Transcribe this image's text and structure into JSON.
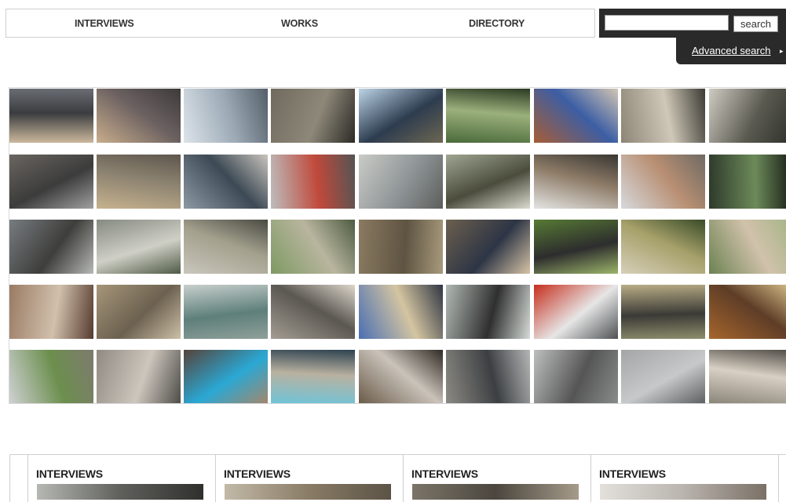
{
  "nav": {
    "interviews": "INTERVIEWS",
    "works": "WORKS",
    "directory": "DIRECTORY"
  },
  "search": {
    "value": "",
    "button_label": "search",
    "advanced_label": "Advanced search",
    "advanced_arrow": "▸"
  },
  "grid": {
    "rows": 5,
    "cols": 9,
    "thumbnails": [
      [
        "#cbb89c",
        "#3a3c40",
        "#6a6e74"
      ],
      [
        "#c9ad8c",
        "#6a6060",
        "#3e3a3a"
      ],
      [
        "#dde4ea",
        "#9aa8b4",
        "#545f68"
      ],
      [
        "#6f6a5e",
        "#8e8879",
        "#2c2a26"
      ],
      [
        "#bcd3e6",
        "#2d3c4f",
        "#6d6752"
      ],
      [
        "#4a6a3a",
        "#9bb07c",
        "#2a3a22"
      ],
      [
        "#a75d36",
        "#3c5ea4",
        "#d2c6b4"
      ],
      [
        "#8d8576",
        "#cfc8b8",
        "#3c3a34"
      ],
      [
        "#cfcbc2",
        "#5a5a50",
        "#2d2f2a"
      ],
      [
        "#6a6560",
        "#3c3c3c",
        "#a0a0a0"
      ],
      [
        "#c6b28e",
        "#8c8270",
        "#5d564c"
      ],
      [
        "#8d99a5",
        "#3d4a55",
        "#c9c4bd"
      ],
      [
        "#bdbdbd",
        "#c0493b",
        "#545454"
      ],
      [
        "#c9cbc6",
        "#8e9496",
        "#5c5e5b"
      ],
      [
        "#9fa692",
        "#4b4c3c",
        "#dbdcd0"
      ],
      [
        "#e4e4e2",
        "#8d7b67",
        "#383632"
      ],
      [
        "#d7d9dc",
        "#b88f73",
        "#6f6a63"
      ],
      [
        "#2e3a2b",
        "#6d8a5a",
        "#151a13"
      ],
      [
        "#777c80",
        "#3e3e3b",
        "#b7b9b6"
      ],
      [
        "#868a80",
        "#cfcfc6",
        "#4f5a45"
      ],
      [
        "#c9c6bc",
        "#a3a08d",
        "#4a4a42"
      ],
      [
        "#7e9a62",
        "#b9b59f",
        "#4d5c41"
      ],
      [
        "#8a7a60",
        "#5e5442",
        "#a89a7c"
      ],
      [
        "#6c5f4e",
        "#2d3545",
        "#d7c4a6"
      ],
      [
        "#577a34",
        "#2d2d2d",
        "#9cb56a"
      ],
      [
        "#d7cfb9",
        "#a6a06a",
        "#384b28"
      ],
      [
        "#6c8252",
        "#d1c2ab",
        "#a3b385"
      ],
      [
        "#9a7b64",
        "#d1c0ac",
        "#553a2e"
      ],
      [
        "#a69579",
        "#6c6150",
        "#cbbfa6"
      ],
      [
        "#c7cfcc",
        "#5e7f7b",
        "#8fa09a"
      ],
      [
        "#a39d92",
        "#5b5751",
        "#ddd7cc"
      ],
      [
        "#4a6fb3",
        "#d4c5a1",
        "#2f3543"
      ],
      [
        "#b1b9b4",
        "#2f2f2f",
        "#d6dcd8"
      ],
      [
        "#c62e1d",
        "#e6e6e6",
        "#4e5053"
      ],
      [
        "#b9ad86",
        "#3b3a36",
        "#8d8e6c"
      ],
      [
        "#a6652c",
        "#5e3d27",
        "#d7c08a"
      ],
      [
        "#cfd1d3",
        "#6c8f4e",
        "#7e7a6e"
      ],
      [
        "#908a82",
        "#cdc6bd",
        "#4e4c48"
      ],
      [
        "#56433a",
        "#2aa8d4",
        "#a3876b"
      ],
      [
        "#6ec4d9",
        "#b9b1a0",
        "#2d4250"
      ],
      [
        "#6a5a48",
        "#c9c3ba",
        "#302a24"
      ],
      [
        "#8c8a84",
        "#3c3f42",
        "#b4b6b5"
      ],
      [
        "#bdbebe",
        "#555555",
        "#8a8c8c"
      ],
      [
        "#a3a5a7",
        "#c6c8ca",
        "#5c5e60"
      ],
      [
        "#8a8478",
        "#d8d0c4",
        "#4e4a44"
      ]
    ]
  },
  "strip": {
    "cards": [
      {
        "title": "INTERVIEWS",
        "image": [
          "#b6b8b4",
          "#5f605c",
          "#2f302d"
        ]
      },
      {
        "title": "INTERVIEWS",
        "image": [
          "#c2b9a8",
          "#8a7c66",
          "#5b5346"
        ]
      },
      {
        "title": "INTERVIEWS",
        "image": [
          "#7b7468",
          "#4b463e",
          "#a59b8a"
        ]
      },
      {
        "title": "INTERVIEWS",
        "image": [
          "#e3e0dc",
          "#b9b4ae",
          "#7a7066"
        ]
      }
    ]
  }
}
